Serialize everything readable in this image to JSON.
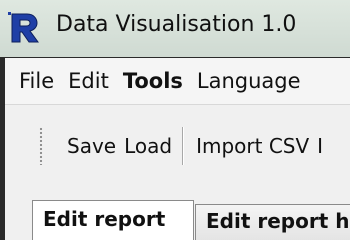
{
  "window": {
    "title": "Data Visualisation 1.0",
    "icon": "r-logo-icon"
  },
  "menubar": {
    "items": [
      {
        "label": "File",
        "bold": false
      },
      {
        "label": "Edit",
        "bold": false
      },
      {
        "label": "Tools",
        "bold": true
      },
      {
        "label": "Language",
        "bold": false
      }
    ]
  },
  "toolbar": {
    "save_label": "Save",
    "load_label": "Load",
    "import_csv_label": "Import CSV",
    "next_label": "I"
  },
  "tabs": [
    {
      "label": "Edit report",
      "active": true
    },
    {
      "label": "Edit report h",
      "active": false
    }
  ],
  "colors": {
    "titlebar": "#cfdad2",
    "border": "#2a2a2a",
    "menubar": "#f5f5f5",
    "client": "#f0f0f0",
    "icon_blue": "#1f3fa6"
  }
}
